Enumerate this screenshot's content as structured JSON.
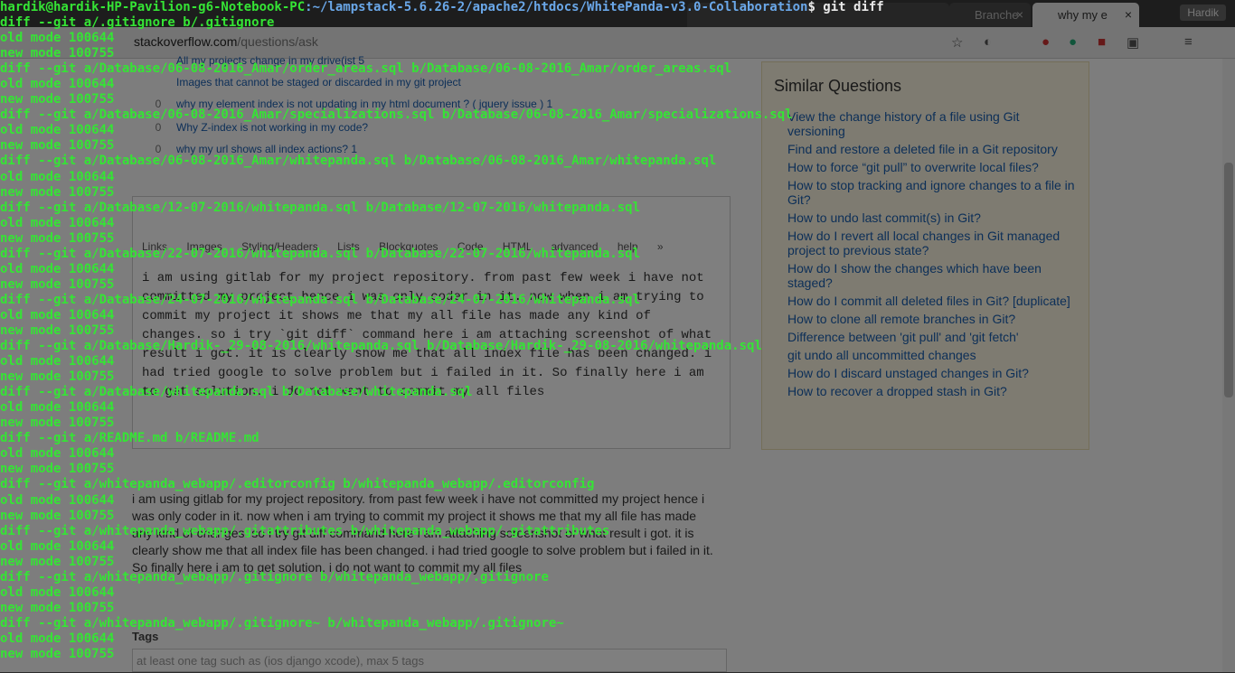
{
  "browser": {
    "tabs": [
      "",
      "",
      "Branche",
      "why my e"
    ],
    "active_tab_index": 3,
    "user_badge": "Hardik",
    "url_host": "stackoverflow.com",
    "url_path": "/questions/ask",
    "similar_rows": [
      {
        "votes": "",
        "title": "All my projects change in my drive(ist 5"
      },
      {
        "votes": "",
        "title": "Images that cannot be staged or discarded in my git project"
      },
      {
        "votes": "0",
        "title": "why my element index is not updating in my html document ? ( jquery issue ) 1"
      },
      {
        "votes": "0",
        "title": "Why Z-index is not working in my code?"
      },
      {
        "votes": "0",
        "title": "why my url shows all index actions? 1"
      }
    ],
    "editor_menu": [
      "Links",
      "Images",
      "Styling/Headers",
      "Lists",
      "Blockquotes",
      "Code",
      "HTML",
      "advanced help »"
    ],
    "editor_body": "i am using gitlab for my project repository. from past few week i have not committed my project hence i was only coder in it. now when i am trying to commit my project it shows me that my all file has made any kind of changes. so i try `git diff` command here i am attaching screenshot of what result i got. it is clearly show me that all index file has been changed. i had tried google to solve problem but i failed in it. So finally here i am to get solution. i do not want to commit my all files",
    "preview_body": "i am using gitlab for my project repository. from past few week i have not committed my project hence i was only coder in it. now when i am trying to commit my project it shows me that my all file has made any kind of changes. so i try git diff command here i am attaching screenshot of what result i got. it is clearly show me that all index file has been changed. i had tried google to solve problem but i failed in it. So finally here i am to get solution. i do not want to commit my all files",
    "tags_label": "Tags",
    "tags_placeholder": "at least one tag such as (ios django xcode), max 5 tags",
    "similar_title": "Similar Questions",
    "similar_links": [
      "View the change history of a file using Git versioning",
      "Find and restore a deleted file in a Git repository",
      "How to force “git pull” to overwrite local files?",
      "How to stop tracking and ignore changes to a file in Git?",
      "How to undo last commit(s) in Git?",
      "How do I revert all local changes in Git managed project to previous state?",
      "How do I show the changes which have been staged?",
      "How do I commit all deleted files in Git? [duplicate]",
      "How to clone all remote branches in Git?",
      "Difference between 'git pull' and 'git fetch'",
      "git undo all uncommitted changes",
      "How do I discard unstaged changes in Git?",
      "How to recover a dropped stash in Git?"
    ]
  },
  "terminal": {
    "prompt_user": "hardik@hardik-HP-Pavilion-g6-Notebook-PC",
    "prompt_path": ":~/lampstack-5.6.26-2/apache2/htdocs/WhitePanda-v3.0-Collaboration",
    "prompt_cmd": "$ git diff",
    "lines": [
      "diff --git a/.gitignore b/.gitignore",
      "old mode 100644",
      "new mode 100755",
      "diff --git a/Database/06-08-2016_Amar/order_areas.sql b/Database/06-08-2016_Amar/order_areas.sql",
      "old mode 100644",
      "new mode 100755",
      "diff --git a/Database/06-08-2016_Amar/specializations.sql b/Database/06-08-2016_Amar/specializations.sql",
      "old mode 100644",
      "new mode 100755",
      "diff --git a/Database/06-08-2016_Amar/whitepanda.sql b/Database/06-08-2016_Amar/whitepanda.sql",
      "old mode 100644",
      "new mode 100755",
      "diff --git a/Database/12-07-2016/whitepanda.sql b/Database/12-07-2016/whitepanda.sql",
      "old mode 100644",
      "new mode 100755",
      "diff --git a/Database/22-07-2016/whitepanda.sql b/Database/22-07-2016/whitepanda.sql",
      "old mode 100644",
      "new mode 100755",
      "diff --git a/Database/24-07-2016/whitepanda.sql b/Database/24-07-2016/whitepanda.sql",
      "old mode 100644",
      "new mode 100755",
      "diff --git a/Database/Hardik-_29-08-2016/whitepanda.sql b/Database/Hardik-_29-08-2016/whitepanda.sql",
      "old mode 100644",
      "new mode 100755",
      "diff --git a/Database/whitepanda.sql b/Database/whitepanda.sql",
      "old mode 100644",
      "new mode 100755",
      "diff --git a/README.md b/README.md",
      "old mode 100644",
      "new mode 100755",
      "diff --git a/whitepanda_webapp/.editorconfig b/whitepanda_webapp/.editorconfig",
      "old mode 100644",
      "new mode 100755",
      "diff --git a/whitepanda_webapp/.gitattributes b/whitepanda_webapp/.gitattributes",
      "old mode 100644",
      "new mode 100755",
      "diff --git a/whitepanda_webapp/.gitignore b/whitepanda_webapp/.gitignore",
      "old mode 100644",
      "new mode 100755",
      "diff --git a/whitepanda_webapp/.gitignore~ b/whitepanda_webapp/.gitignore~",
      "old mode 100644",
      "new mode 100755"
    ]
  }
}
